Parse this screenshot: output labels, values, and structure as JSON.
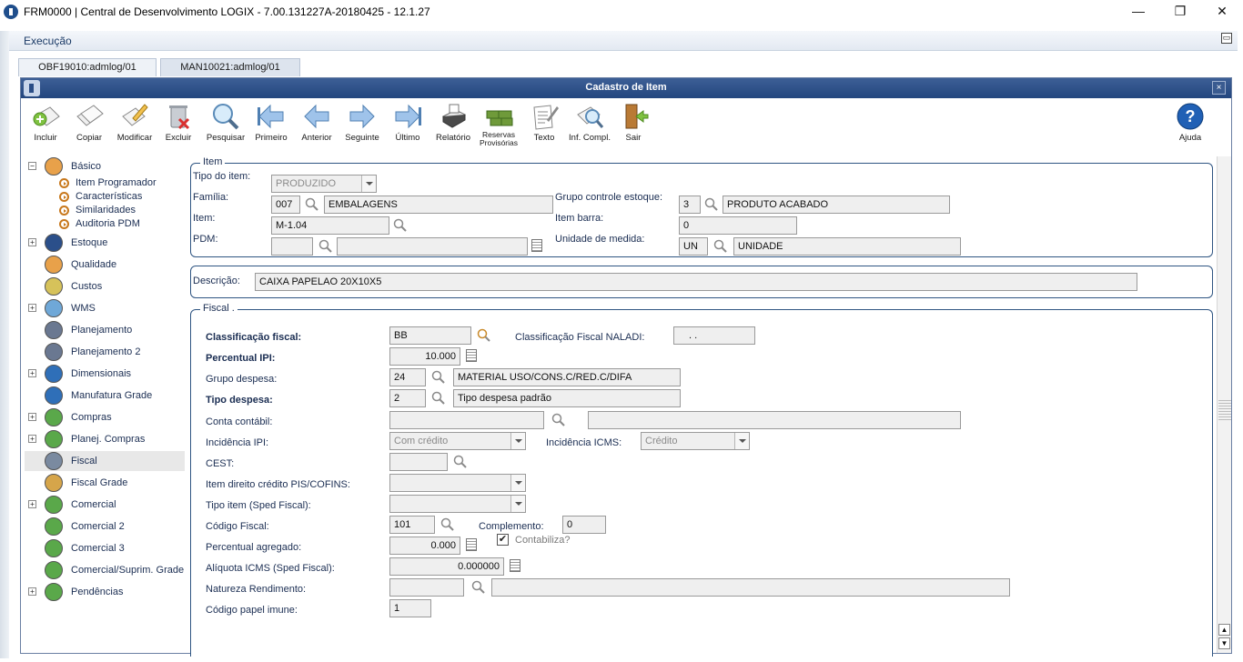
{
  "window": {
    "title": "FRM0000 | Central de Desenvolvimento LOGIX  -  7.00.131227A-20180425  -  12.1.27",
    "minimize": "—",
    "maximize": "❐",
    "close": "✕"
  },
  "menubar": {
    "menu": "Execução",
    "restore": "▭"
  },
  "tabs": [
    {
      "label": "OBF19010:admlog/01",
      "active": false
    },
    {
      "label": "MAN10021:admlog/01",
      "active": true
    }
  ],
  "inner": {
    "title": "Cadastro de Item",
    "close": "×"
  },
  "toolbar": {
    "incluir": "Incluir",
    "copiar": "Copiar",
    "modificar": "Modificar",
    "excluir": "Excluir",
    "pesquisar": "Pesquisar",
    "primeiro": "Primeiro",
    "anterior": "Anterior",
    "seguinte": "Seguinte",
    "ultimo": "Último",
    "relatorio": "Relatório",
    "reservas_1": "Reservas",
    "reservas_2": "Provisórias",
    "texto": "Texto",
    "inf_compl": "Inf. Compl.",
    "sair": "Sair",
    "ajuda": "Ajuda"
  },
  "tree": {
    "basico": "Básico",
    "basico_children": [
      "Item Programador",
      "Características",
      "Similaridades",
      "Auditoria PDM"
    ],
    "estoque": "Estoque",
    "qualidade": "Qualidade",
    "custos": "Custos",
    "wms": "WMS",
    "planejamento": "Planejamento",
    "planejamento2": "Planejamento 2",
    "dimensionais": "Dimensionais",
    "manufatura_grade": "Manufatura Grade",
    "compras": "Compras",
    "planej_compras": "Planej. Compras",
    "fiscal": "Fiscal",
    "fiscal_grade": "Fiscal Grade",
    "comercial": "Comercial",
    "comercial2": "Comercial 2",
    "comercial3": "Comercial 3",
    "comercial_suprim": "Comercial/Suprim. Grade",
    "pendencias": "Pendências"
  },
  "item_group": {
    "title": "Item",
    "tipo_label": "Tipo do item:",
    "tipo_value": "PRODUZIDO",
    "familia_label": "Família:",
    "familia_code": "007",
    "familia_desc": "EMBALAGENS",
    "item_label": "Item:",
    "item_value": "M-1.04",
    "pdm_label": "PDM:",
    "pdm_code": "",
    "pdm_desc": "",
    "grupo_label": "Grupo controle estoque:",
    "grupo_code": "3",
    "grupo_desc": "PRODUTO ACABADO",
    "barra_label": "Item barra:",
    "barra_value": "0",
    "unidade_label": "Unidade de medida:",
    "unidade_code": "UN",
    "unidade_desc": "UNIDADE"
  },
  "descricao": {
    "label": "Descrição:",
    "value": "CAIXA PAPELAO 20X10X5"
  },
  "fiscal_group": {
    "title": "Fiscal .",
    "class_fiscal_label": "Classificação fiscal:",
    "class_fiscal_value": "BB",
    "naladi_label": "Classificação Fiscal NALADI:",
    "naladi_value": ". .",
    "ipi_label": "Percentual IPI:",
    "ipi_value": "10.000",
    "grupo_despesa_label": "Grupo despesa:",
    "grupo_despesa_code": "24",
    "grupo_despesa_desc": "MATERIAL USO/CONS.C/RED.C/DIFA",
    "tipo_despesa_label": "Tipo despesa:",
    "tipo_despesa_code": "2",
    "tipo_despesa_desc": "Tipo despesa padrão",
    "conta_label": "Conta contábil:",
    "conta_code": "",
    "conta_desc": "",
    "inc_ipi_label": "Incidência IPI:",
    "inc_ipi_value": "Com crédito",
    "inc_icms_label": "Incidência ICMS:",
    "inc_icms_value": "Crédito",
    "cest_label": "CEST:",
    "cest_value": "",
    "pis_label": "Item direito crédito PIS/COFINS:",
    "pis_value": "",
    "sped_label": "Tipo item (Sped Fiscal):",
    "sped_value": "",
    "cod_fiscal_label": "Código Fiscal:",
    "cod_fiscal_value": "101",
    "complemento_label": "Complemento:",
    "complemento_value": "0",
    "perc_agregado_label": "Percentual agregado:",
    "perc_agregado_value": "0.000",
    "contabiliza_label": "Contabiliza?",
    "contabiliza_checked": "✔",
    "aliquota_label": "Alíquota ICMS (Sped Fiscal):",
    "aliquota_value": "0.000000",
    "natureza_label": "Natureza Rendimento:",
    "natureza_code": "",
    "natureza_desc": "",
    "papel_label": "Código papel imune:",
    "papel_value": "1"
  }
}
